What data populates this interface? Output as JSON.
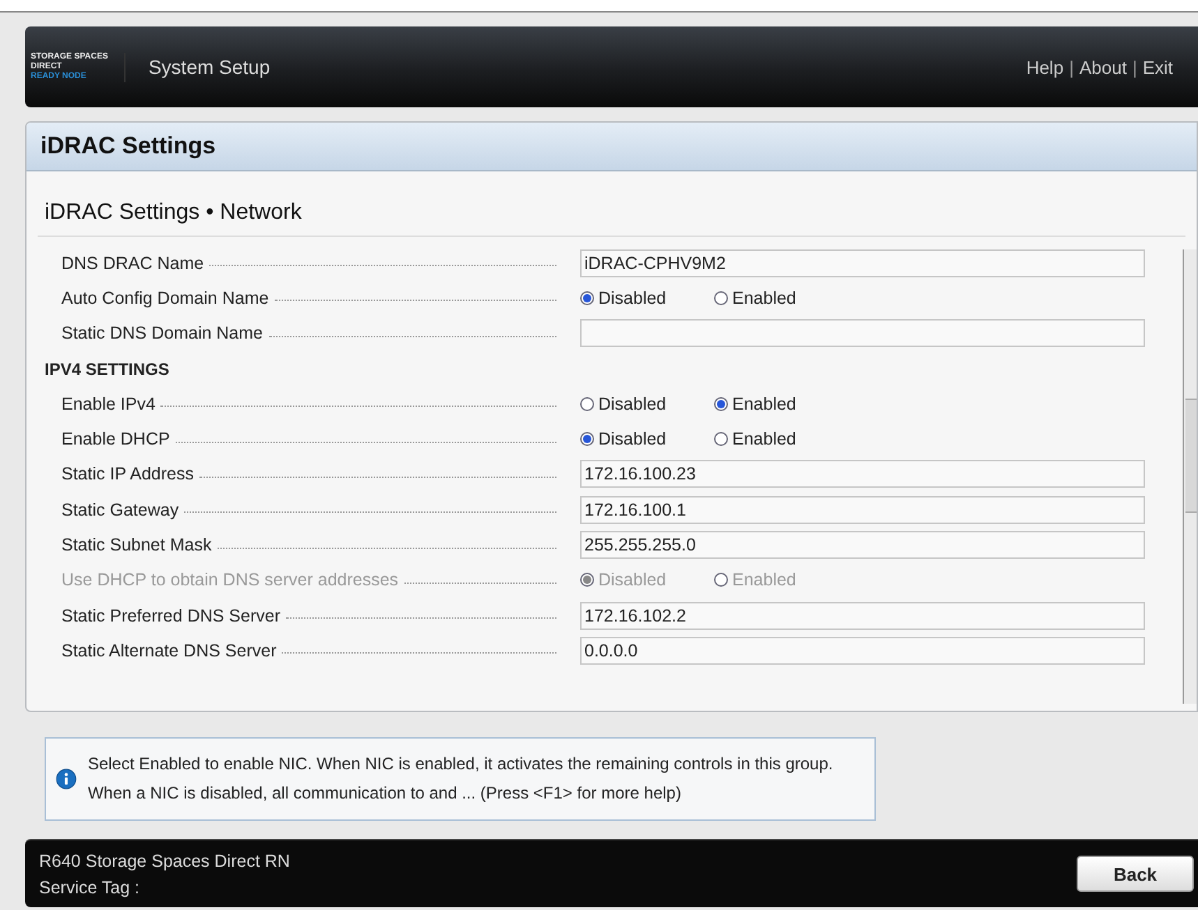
{
  "header": {
    "logo": [
      "STORAGE SPACES",
      "DIRECT",
      "READY NODE"
    ],
    "title": "System Setup",
    "links": [
      {
        "kind": "link",
        "label": "Help"
      },
      {
        "kind": "separator",
        "label": "|"
      },
      {
        "kind": "link",
        "label": "About"
      },
      {
        "kind": "separator",
        "label": "|"
      },
      {
        "kind": "link",
        "label": "Exit"
      }
    ]
  },
  "panel": {
    "title": "iDRAC Settings",
    "subtitle": "iDRAC Settings • Network",
    "rows": [
      {
        "kind": "text",
        "label": "DNS DRAC Name",
        "value": "iDRAC-CPHV9M2",
        "disabled": false
      },
      {
        "kind": "radio",
        "label": "Auto Config Domain Name",
        "disabled": false,
        "options": [
          {
            "label": "Disabled",
            "selected": true
          },
          {
            "label": "Enabled",
            "selected": false
          }
        ]
      },
      {
        "kind": "text",
        "label": "Static DNS Domain Name",
        "disabled": false
      },
      {
        "kind": "heading",
        "label": "IPV4 SETTINGS",
        "disabled": false
      },
      {
        "kind": "radio",
        "label": "Enable IPv4",
        "disabled": false,
        "options": [
          {
            "label": "Disabled",
            "selected": false
          },
          {
            "label": "Enabled",
            "selected": true
          }
        ]
      },
      {
        "kind": "radio",
        "label": "Enable DHCP",
        "disabled": false,
        "options": [
          {
            "label": "Disabled",
            "selected": true
          },
          {
            "label": "Enabled",
            "selected": false
          }
        ]
      },
      {
        "kind": "text",
        "label": "Static IP Address",
        "value": "172.16.100.23",
        "disabled": false
      },
      {
        "kind": "text",
        "label": "Static Gateway",
        "value": "172.16.100.1",
        "disabled": false
      },
      {
        "kind": "text",
        "label": "Static Subnet Mask",
        "value": "255.255.255.0",
        "disabled": false
      },
      {
        "kind": "radio",
        "label": "Use DHCP to obtain DNS server addresses",
        "disabled": true,
        "options": [
          {
            "label": "Disabled",
            "selected": true
          },
          {
            "label": "Enabled",
            "selected": false
          }
        ]
      },
      {
        "kind": "text",
        "label": "Static Preferred DNS Server",
        "value": "172.16.102.2",
        "disabled": false
      },
      {
        "kind": "text",
        "label": "Static Alternate DNS Server",
        "value": "0.0.0.0",
        "disabled": false
      }
    ]
  },
  "help": {
    "text": "Select Enabled to enable NIC. When NIC is enabled, it activates the remaining controls in this group. When a NIC is disabled, all communication to and ... (Press <F1> for more help)"
  },
  "footer": {
    "model": "R640 Storage Spaces Direct RN",
    "service_tag": "Service Tag :",
    "button": "Back"
  }
}
